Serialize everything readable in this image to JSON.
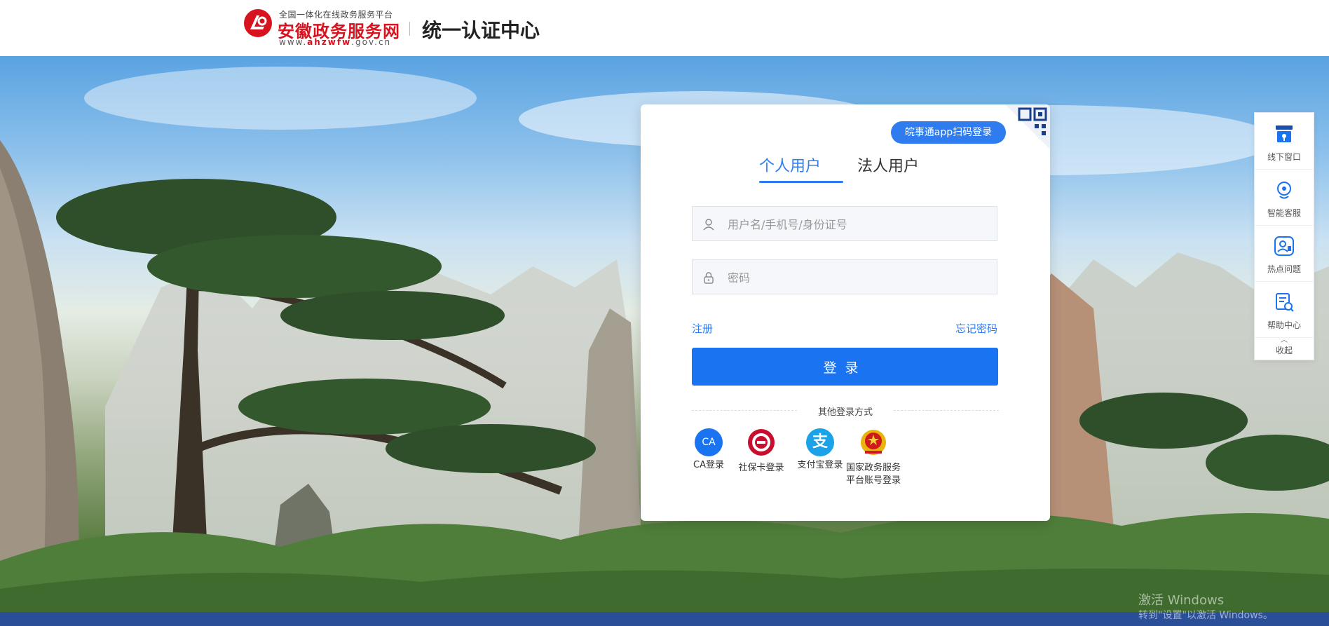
{
  "header": {
    "logo_subtitle": "全国一体化在线政务服务平台",
    "logo_name": "安徽政务服务网",
    "logo_url_prefix": "www.",
    "logo_url_domain": "ahzwfw",
    "logo_url_suffix": ".gov.cn",
    "title": "统一认证中心"
  },
  "login": {
    "qr_badge": "皖事通app扫码登录",
    "tabs": [
      {
        "label": "个人用户",
        "active": true
      },
      {
        "label": "法人用户",
        "active": false
      }
    ],
    "username_placeholder": "用户名/手机号/身份证号",
    "password_placeholder": "密码",
    "register_label": "注册",
    "forgot_label": "忘记密码",
    "login_button": "登录",
    "other_methods_title": "其他登录方式",
    "other_methods": [
      {
        "label": "CA登录",
        "icon": "ca-icon",
        "icon_text": "CA"
      },
      {
        "label": "社保卡登录",
        "icon": "social-security-card-icon"
      },
      {
        "label": "支付宝登录",
        "icon": "alipay-icon",
        "icon_text": "支"
      },
      {
        "label": "国家政务服务平台账号登录",
        "label_line1": "国家政务服务",
        "label_line2": "平台账号登录",
        "icon": "national-emblem-icon"
      }
    ]
  },
  "sidebar": {
    "items": [
      {
        "label": "线下窗口",
        "icon": "store-location-icon"
      },
      {
        "label": "智能客服",
        "icon": "smart-service-icon"
      },
      {
        "label": "热点问题",
        "icon": "hot-question-icon"
      },
      {
        "label": "帮助中心",
        "icon": "help-center-icon"
      }
    ],
    "collapse_label": "收起"
  },
  "watermark": {
    "line1": "激活 Windows",
    "line2": "转到\"设置\"以激活 Windows。"
  },
  "colors": {
    "primary": "#1a73f0",
    "logo_red": "#d6131e",
    "bottom_bar": "#2a4f98"
  }
}
